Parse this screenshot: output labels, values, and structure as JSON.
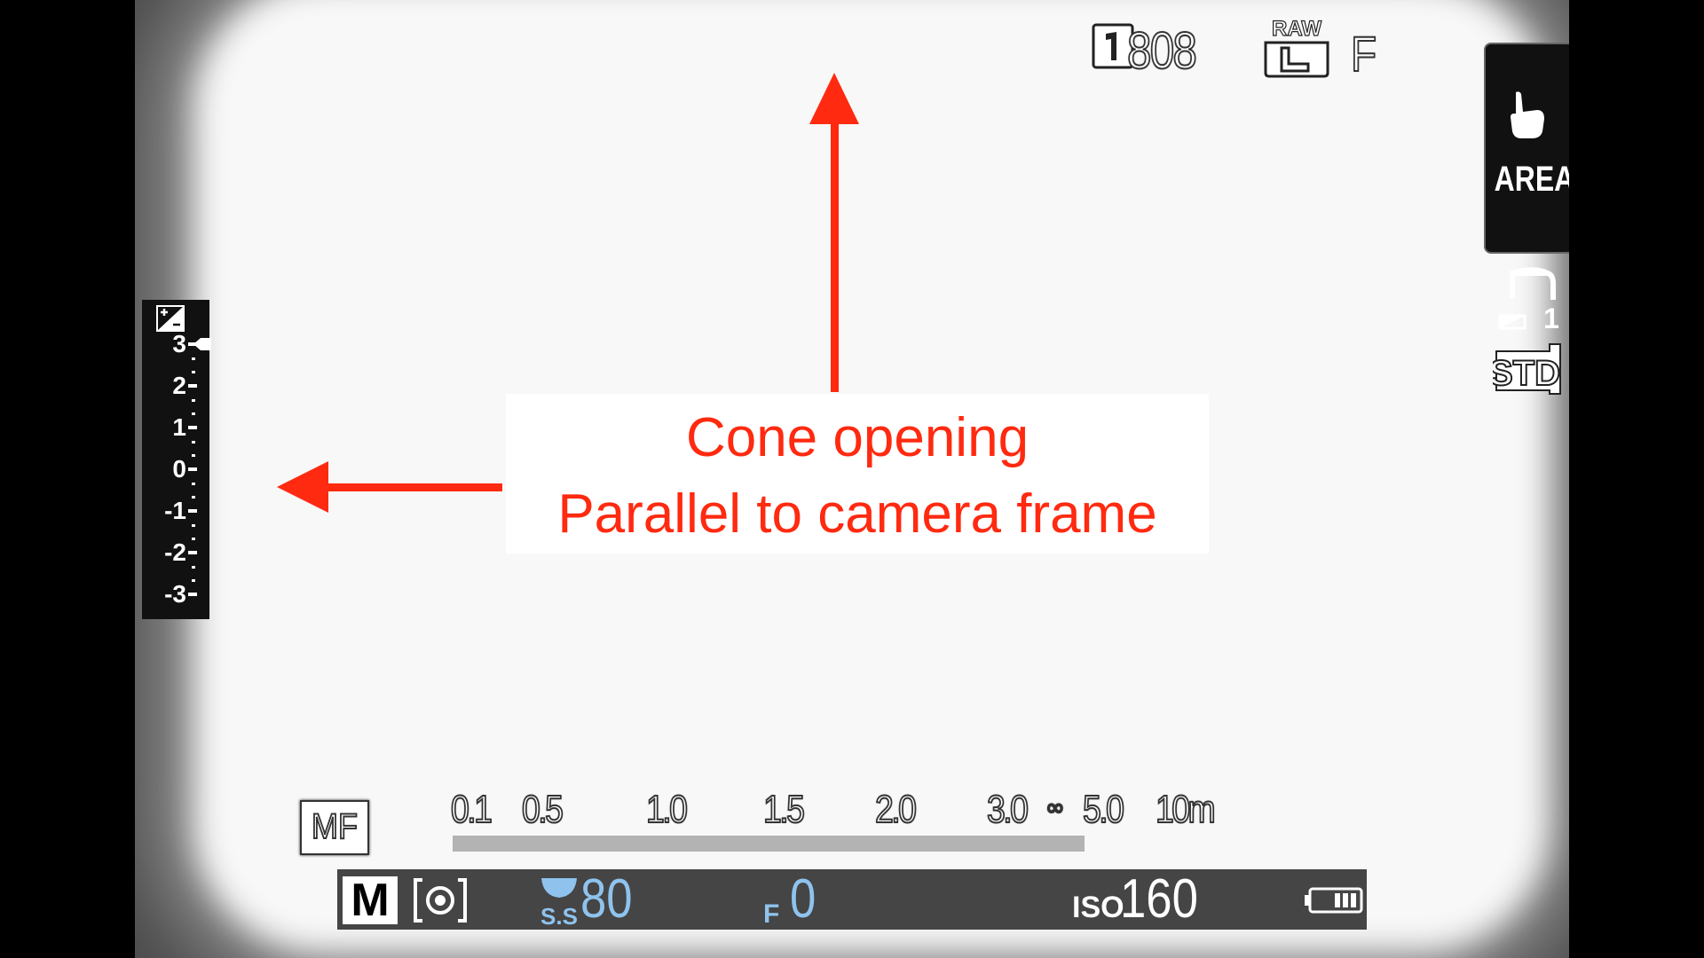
{
  "status": {
    "frame_count": "808",
    "raw_label": "RAW",
    "raw_size": "L",
    "quality": "F"
  },
  "touch_panel": {
    "label": "AREA"
  },
  "dr_index": "1",
  "film_sim": "STD",
  "exposure_comp": {
    "labels": [
      "3",
      "2",
      "1",
      "0",
      "-1",
      "-2",
      "-3"
    ],
    "value": 3
  },
  "focus": {
    "mode": "MF",
    "distances": [
      "0.1",
      "0.5",
      "1.0",
      "1.5",
      "2.0",
      "3.0",
      "5.0",
      "10m"
    ],
    "infinity": "∞"
  },
  "exposure": {
    "mode": "M",
    "ss_icon": "S.S",
    "shutter": "80",
    "f_icon": "F",
    "aperture": "0",
    "iso_label": "ISO",
    "iso": "160"
  },
  "annotation": {
    "line1": "Cone opening",
    "line2": "Parallel to camera frame",
    "color": "#ff2a10"
  },
  "icons": {
    "single": "single-frame-icon",
    "raw": "raw-l-icon",
    "touch": "touch-finger-icon",
    "dr": "dynamic-range-icon",
    "std": "film-sim-std-icon",
    "ev": "exposure-comp-icon",
    "meter": "metering-icon",
    "battery": "battery-icon"
  }
}
